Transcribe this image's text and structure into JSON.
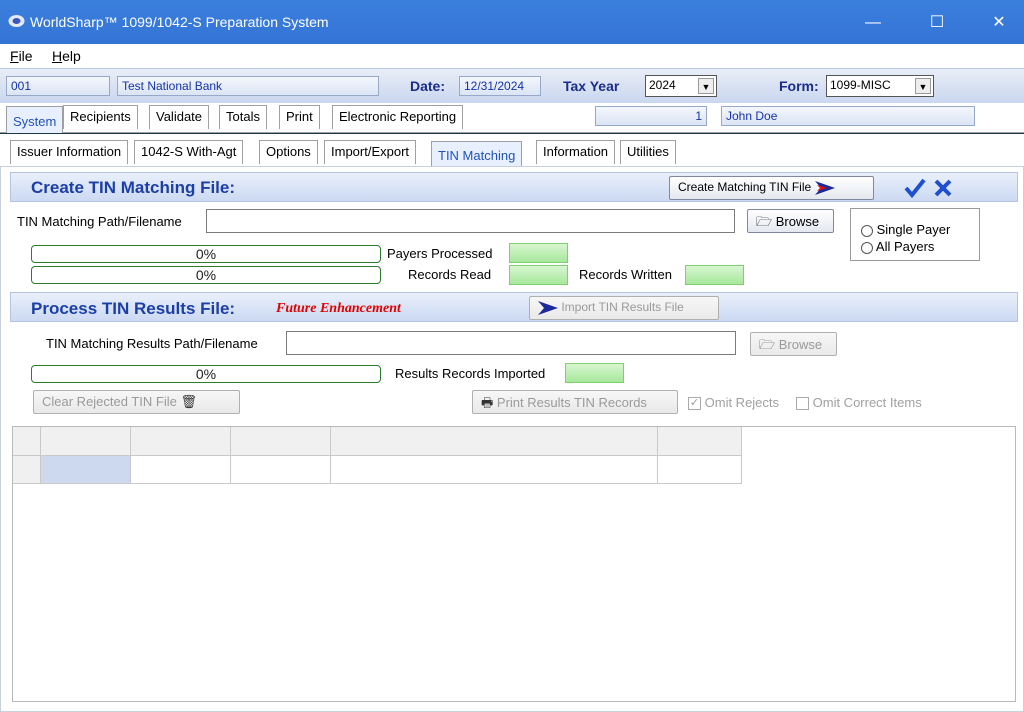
{
  "window": {
    "title": "WorldSharp™ 1099/1042-S Preparation System",
    "minimize_glyph": "—",
    "maximize_glyph": "☐",
    "close_glyph": "✕"
  },
  "menu": [
    {
      "underline": "F",
      "rest": "ile"
    },
    {
      "underline": "H",
      "rest": "elp"
    }
  ],
  "header": {
    "issuer_id": "001",
    "issuer_name": "Test National Bank",
    "date_label": "Date:",
    "date_value": "12/31/2024",
    "tax_year_label": "Tax Year",
    "tax_year_value": "2024",
    "form_label": "Form:",
    "form_value": "1099-MISC",
    "recipient_number": "1",
    "recipient_name": "John Doe"
  },
  "main_tabs": [
    "System",
    "Recipients",
    "Validate",
    "Totals",
    "Print",
    "Electronic Reporting"
  ],
  "sub_tabs": [
    "Issuer Information",
    "1042-S With-Agt",
    "Options",
    "Import/Export",
    "TIN Matching",
    "Information",
    "Utilities"
  ],
  "create": {
    "title": "Create TIN Matching File:",
    "create_button": "Create Matching TIN File",
    "path_label": "TIN Matching Path/Filename",
    "path_value": "",
    "browse_button": "Browse",
    "radio_single": "Single Payer",
    "radio_all": "All Payers",
    "progress1": "0%",
    "progress2": "0%",
    "payers_processed_label": "Payers Processed",
    "records_read_label": "Records Read",
    "records_written_label": "Records Written"
  },
  "process": {
    "title": "Process TIN Results File:",
    "future_label": "Future Enhancement",
    "import_button": "Import TIN Results File",
    "path_label": "TIN Matching Results Path/Filename",
    "path_value": "",
    "browse_button": "Browse",
    "progress": "0%",
    "imported_label": "Results Records Imported",
    "clear_button": "Clear Rejected TIN File",
    "print_button": "Print Results TIN Records",
    "omit_rejects": "Omit Rejects",
    "omit_correct": "Omit Correct Items"
  },
  "colors": {
    "titlebar": "#3474d6",
    "section_title": "#1c3fa6",
    "future_red": "#e00000",
    "progress_border": "#2d7a2d",
    "check_blue": "#1d4fd0"
  }
}
